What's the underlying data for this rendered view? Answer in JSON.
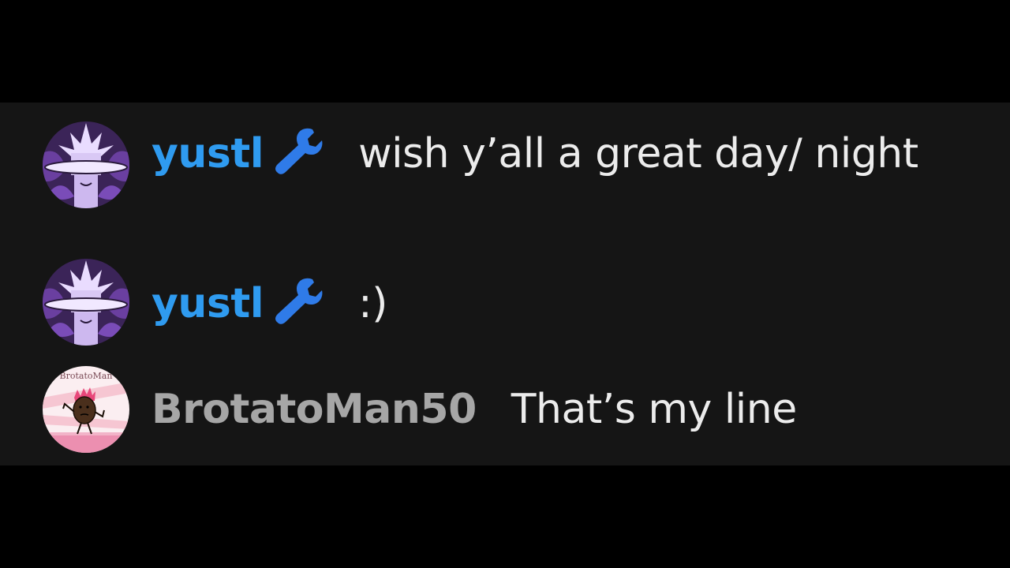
{
  "messages": [
    {
      "username": "yustl",
      "badge_icon": "wrench-icon",
      "badge_color": "#2f7be8",
      "username_color": "#2f9bf0",
      "text": "wish y’all a great day/ night",
      "avatar": "purple-character-avatar"
    },
    {
      "username": "yustl",
      "badge_icon": "wrench-icon",
      "badge_color": "#2f7be8",
      "username_color": "#2f9bf0",
      "text": ":)",
      "avatar": "purple-character-avatar"
    },
    {
      "username": "BrotatoMan50",
      "username_color": "#a6a6a6",
      "text": "That’s my line",
      "avatar": "brotato-avatar",
      "avatar_text": "BrotatoMan"
    }
  ],
  "colors": {
    "background": "#000000",
    "panel": "#151515",
    "message_text": "#ececec"
  }
}
